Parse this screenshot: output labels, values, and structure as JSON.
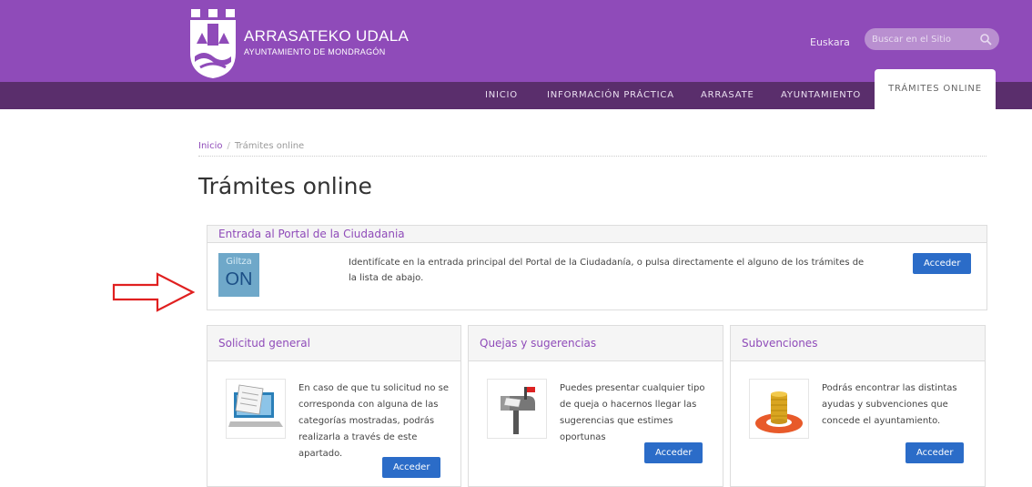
{
  "header": {
    "brand_title": "ARRASATEKO UDALA",
    "brand_subtitle": "AYUNTAMIENTO DE MONDRAGÓN",
    "language_link": "Euskara",
    "search_placeholder": "Buscar en el Sitio",
    "colors": {
      "top_bar": "#8f4bb9",
      "nav_bar": "#5a2e6c",
      "button": "#2b6cc8"
    }
  },
  "nav": {
    "items": [
      "INICIO",
      "INFORMACIÓN PRÁCTICA",
      "ARRASATE",
      "AYUNTAMIENTO"
    ],
    "active_label": "TRÁMITES ONLINE"
  },
  "breadcrumb": {
    "home": "Inicio",
    "separator": "/",
    "current": "Trámites online"
  },
  "page_title": "Trámites online",
  "portal": {
    "heading": "Entrada al Portal de la Ciudadania",
    "logo_line1": "Giltza",
    "logo_line2": "ON",
    "text": "Identifícate en la entrada principal del Portal de la Ciudadanía, o pulsa directamente el alguno de los trámites de la lista de abajo.",
    "button": "Acceder"
  },
  "cards": [
    {
      "heading": "Solicitud general",
      "icon": "document-laptop-icon",
      "text": "En caso de que tu solicitud no se corresponda con alguna de las categorías mostradas, podrás realizarla a través de este apartado.",
      "button": "Acceder"
    },
    {
      "heading": "Quejas y sugerencias",
      "icon": "mailbox-icon",
      "text": "Puedes presentar cualquier tipo de queja o hacernos llegar las sugerencias que estimes oportunas",
      "button": "Acceder"
    },
    {
      "heading": "Subvenciones",
      "icon": "coins-lifebuoy-icon",
      "text": "Podrás encontrar las distintas ayudas y subvenciones que concede el ayuntamiento.",
      "button": "Acceder"
    }
  ]
}
